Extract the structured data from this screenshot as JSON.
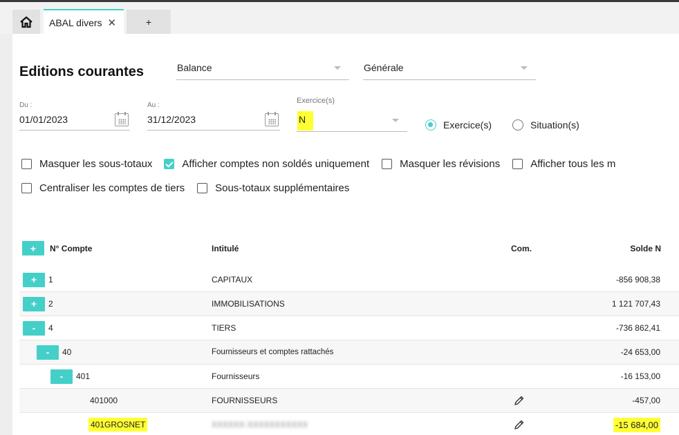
{
  "tabs": {
    "active_label": "ABAL divers",
    "add_label": "+"
  },
  "header": {
    "title": "Editions courantes",
    "select_type": "Balance",
    "select_mode": "Générale"
  },
  "filters": {
    "du_label": "Du :",
    "du_value": "01/01/2023",
    "au_label": "Au :",
    "au_value": "31/12/2023",
    "exercice_label": "Exercice(s)",
    "exercice_value": "N",
    "radio_exercice": "Exercice(s)",
    "radio_situation": "Situation(s)"
  },
  "checkboxes": {
    "masquer_sous_totaux": "Masquer les sous-totaux",
    "afficher_non_soldes": "Afficher comptes non soldés uniquement",
    "masquer_revisions": "Masquer les révisions",
    "afficher_tous": "Afficher tous les m",
    "centraliser_tiers": "Centraliser les comptes de tiers",
    "sous_totaux_supp": "Sous-totaux supplémentaires"
  },
  "table": {
    "headers": {
      "expand": "+",
      "compte": "N° Compte",
      "intitule": "Intitulé",
      "com": "Com.",
      "solde": "Solde N"
    },
    "rows": [
      {
        "toggle": "+",
        "compte": "1",
        "intitule": "CAPITAUX",
        "solde": "-856 908,38"
      },
      {
        "toggle": "+",
        "compte": "2",
        "intitule": "IMMOBILISATIONS",
        "solde": "1 121 707,43"
      },
      {
        "toggle": "-",
        "compte": "4",
        "intitule": "TIERS",
        "solde": "-736 862,41"
      },
      {
        "toggle": "-",
        "compte": "40",
        "intitule": "Fournisseurs et comptes rattachés",
        "solde": "-24 653,00"
      },
      {
        "toggle": "-",
        "compte": "401",
        "intitule": "Fournisseurs",
        "solde": "-16 153,00"
      },
      {
        "toggle": "",
        "compte": "401000",
        "intitule": "FOURNISSEURS",
        "solde": "-457,00"
      },
      {
        "toggle": "",
        "compte": "401GROSNET",
        "intitule": "XXXXXX XXXXXXXXXXX",
        "solde": "-15 684,00"
      }
    ]
  },
  "colors": {
    "accent": "#45cfc9",
    "highlight": "#ffff33"
  },
  "icons": {
    "home": "home-icon",
    "close": "close-icon",
    "calendar": "calendar-icon",
    "pencil": "pencil-icon"
  }
}
